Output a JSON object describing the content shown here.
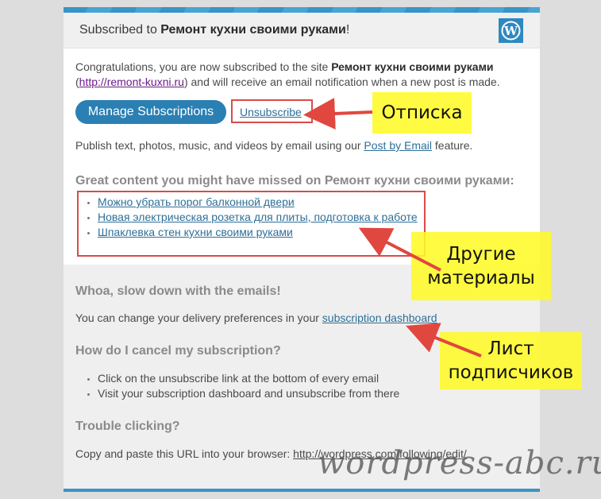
{
  "header": {
    "title_prefix": "Subscribed to ",
    "site_name": "Ремонт кухни своими руками",
    "title_suffix": "!",
    "logo_icon": "wordpress-logo-icon"
  },
  "intro": {
    "line1_prefix": "Congratulations, you are now subscribed to the site ",
    "site_name": "Ремонт кухни своими руками",
    "paren_open": "(",
    "site_url": "http://remont-kuxni.ru",
    "line2_suffix": ") and will receive an email notification when a new post is made."
  },
  "actions": {
    "manage_label": "Manage Subscriptions",
    "unsubscribe_label": "Unsubscribe"
  },
  "post_by_email": {
    "prefix": "Publish text, photos, music, and videos by email using our ",
    "link": "Post by Email",
    "suffix": " feature."
  },
  "great_content": {
    "heading": "Great content you might have missed on Ремонт кухни своими руками:",
    "posts": [
      "Можно убрать порог балконной двери",
      "Новая электрическая розетка для плиты, подготовка к работе",
      "Шпаклевка стен кухни своими руками"
    ]
  },
  "slow_down": {
    "heading": "Whoa, slow down with the emails!",
    "text_prefix": "You can change your delivery preferences in your ",
    "link": "subscription dashboard"
  },
  "cancel": {
    "heading": "How do I cancel my subscription?",
    "items": [
      "Click on the unsubscribe link at the bottom of every email",
      "Visit your subscription dashboard and unsubscribe from there"
    ]
  },
  "trouble": {
    "heading": "Trouble clicking?",
    "text_prefix": "Copy and paste this URL into your browser: ",
    "url": "http://wordpress.com/following/edit/"
  },
  "annotations": {
    "unsubscribe_note": "Отписка",
    "other_materials_note_line1": "Другие",
    "other_materials_note_line2": "материалы",
    "subscribers_note_line1": "Лист",
    "subscribers_note_line2": "подписчиков",
    "accent_color": "#d94b4b",
    "note_color": "#fffa28"
  },
  "watermark": "wordpress-abc.ru",
  "colors": {
    "brand_blue": "#2a7fb3",
    "link": "#2e6f98",
    "heading_gray": "#8a8a8a"
  }
}
